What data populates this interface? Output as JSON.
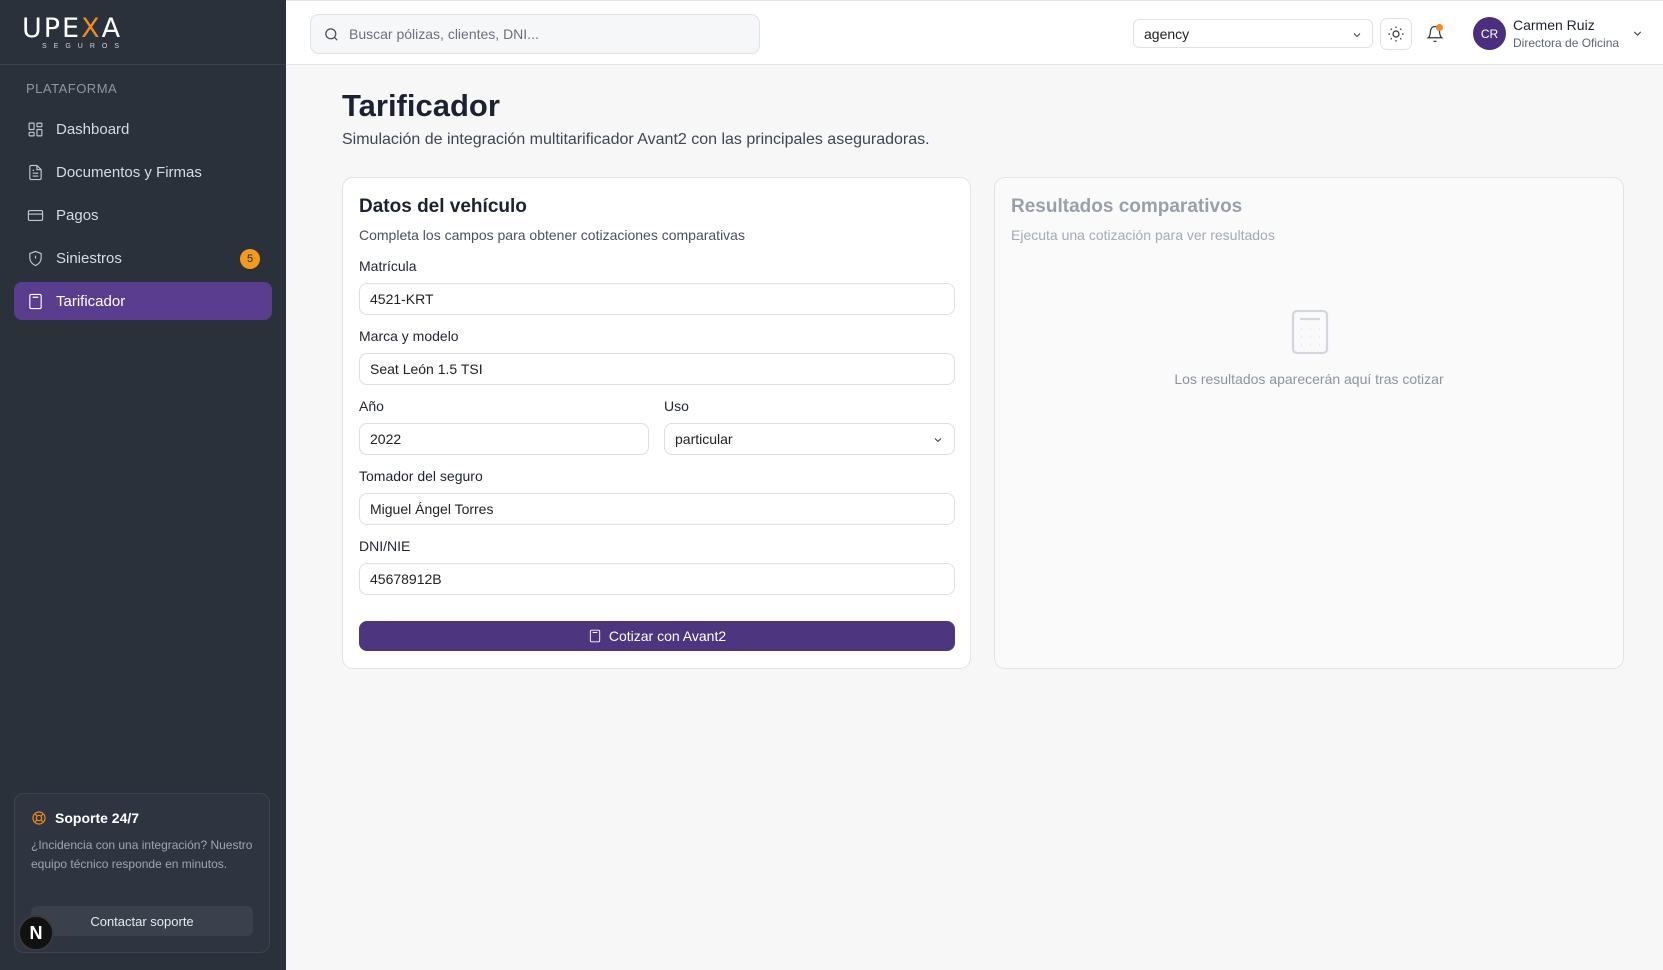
{
  "brand": {
    "logo_main": "UPEXA",
    "logo_sub": "SEGUROS",
    "accent": "#f08a24",
    "primary": "#4e3580"
  },
  "sidebar": {
    "section_label": "PLATAFORMA",
    "items": [
      {
        "label": "Dashboard",
        "icon": "dashboard-icon"
      },
      {
        "label": "Documentos y Firmas",
        "icon": "document-icon"
      },
      {
        "label": "Pagos",
        "icon": "credit-card-icon"
      },
      {
        "label": "Siniestros",
        "icon": "shield-icon",
        "badge": "5"
      },
      {
        "label": "Tarificador",
        "icon": "calculator-icon",
        "active": true
      }
    ],
    "support": {
      "title": "Soporte 24/7",
      "text": "¿Incidencia con una integración? Nuestro equipo técnico responde en minutos.",
      "button": "Contactar soporte"
    },
    "n_badge": "N"
  },
  "header": {
    "search_placeholder": "Buscar pólizas, clientes, DNI...",
    "tenant_select": "agency",
    "user": {
      "initials": "CR",
      "name": "Carmen Ruiz",
      "role": "Directora de Oficina"
    }
  },
  "main": {
    "title": "Tarificador",
    "subtitle": "Simulación de integración multitarificador Avant2 con las principales aseguradoras.",
    "form_card": {
      "title": "Datos del vehículo",
      "description": "Completa los campos para obtener cotizaciones comparativas",
      "fields": {
        "matricula": {
          "label": "Matrícula",
          "value": "4521-KRT"
        },
        "marca": {
          "label": "Marca y modelo",
          "value": "Seat León 1.5 TSI"
        },
        "anio": {
          "label": "Año",
          "value": "2022"
        },
        "uso": {
          "label": "Uso",
          "value": "particular"
        },
        "tomador": {
          "label": "Tomador del seguro",
          "value": "Miguel Ángel Torres"
        },
        "dni": {
          "label": "DNI/NIE",
          "value": "45678912B"
        }
      },
      "submit_label": "Cotizar con Avant2"
    },
    "results_card": {
      "title": "Resultados comparativos",
      "description": "Ejecuta una cotización para ver resultados",
      "empty_text": "Los resultados aparecerán aquí tras cotizar"
    }
  }
}
